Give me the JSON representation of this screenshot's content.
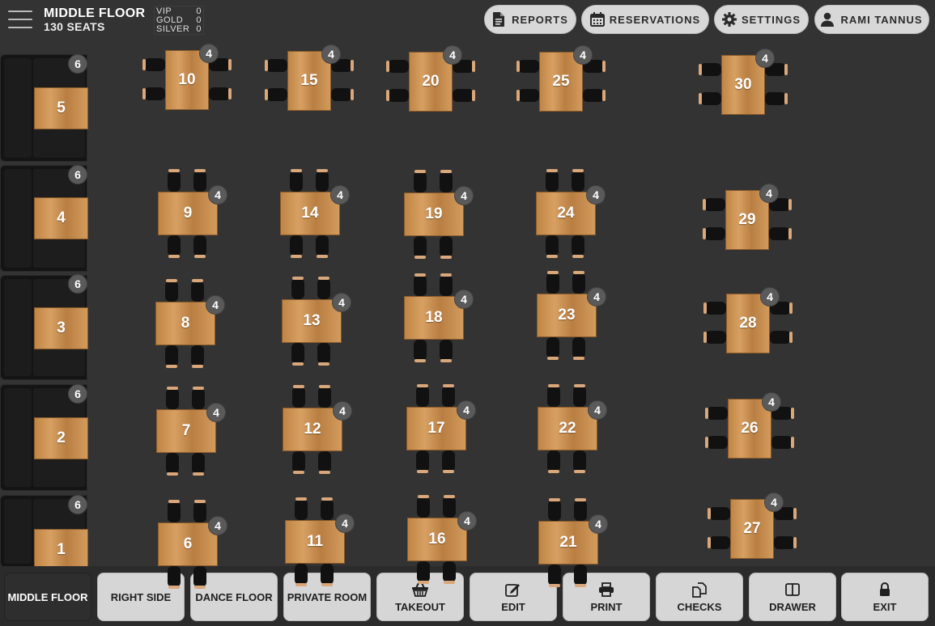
{
  "header": {
    "floor_name": "MIDDLE FLOOR",
    "seats_label": "130 SEATS",
    "tiers": [
      {
        "label": "VIP",
        "count": "0"
      },
      {
        "label": "GOLD",
        "count": "0"
      },
      {
        "label": "SILVER",
        "count": "0"
      }
    ],
    "buttons": {
      "reports": "REPORTS",
      "reservations": "RESERVATIONS",
      "settings": "SETTINGS",
      "user": "RAMI TANNUS"
    },
    "icons": {
      "menu": "hamburger-menu-icon",
      "reports": "document-icon",
      "reservations": "calendar-icon",
      "settings": "gear-icon",
      "user": "user-icon"
    }
  },
  "booths": [
    {
      "number": "5",
      "seats": "6"
    },
    {
      "number": "4",
      "seats": "6"
    },
    {
      "number": "3",
      "seats": "6"
    },
    {
      "number": "2",
      "seats": "6"
    },
    {
      "number": "1",
      "seats": "6"
    }
  ],
  "top_tables": [
    {
      "number": "10",
      "seats": "4"
    },
    {
      "number": "15",
      "seats": "4"
    },
    {
      "number": "20",
      "seats": "4"
    },
    {
      "number": "25",
      "seats": "4"
    },
    {
      "number": "30",
      "seats": "4"
    }
  ],
  "grid_tables": [
    {
      "number": "9",
      "seats": "4"
    },
    {
      "number": "14",
      "seats": "4"
    },
    {
      "number": "19",
      "seats": "4"
    },
    {
      "number": "24",
      "seats": "4"
    },
    {
      "number": "8",
      "seats": "4"
    },
    {
      "number": "13",
      "seats": "4"
    },
    {
      "number": "18",
      "seats": "4"
    },
    {
      "number": "23",
      "seats": "4"
    },
    {
      "number": "7",
      "seats": "4"
    },
    {
      "number": "12",
      "seats": "4"
    },
    {
      "number": "17",
      "seats": "4"
    },
    {
      "number": "22",
      "seats": "4"
    },
    {
      "number": "6",
      "seats": "4"
    },
    {
      "number": "11",
      "seats": "4"
    },
    {
      "number": "16",
      "seats": "4"
    },
    {
      "number": "21",
      "seats": "4"
    }
  ],
  "right_tables": [
    {
      "number": "29",
      "seats": "4"
    },
    {
      "number": "28",
      "seats": "4"
    },
    {
      "number": "26",
      "seats": "4"
    },
    {
      "number": "27",
      "seats": "4"
    }
  ],
  "bottom_bar": {
    "floors": [
      "MIDDLE FLOOR",
      "RIGHT SIDE",
      "DANCE FLOOR",
      "PRIVATE ROOM"
    ],
    "active_floor": "MIDDLE FLOOR",
    "actions": [
      {
        "label": "TAKEOUT",
        "icon": "basket-icon"
      },
      {
        "label": "EDIT",
        "icon": "edit-icon"
      },
      {
        "label": "PRINT",
        "icon": "printer-icon"
      },
      {
        "label": "CHECKS",
        "icon": "checks-icon"
      },
      {
        "label": "DRAWER",
        "icon": "drawer-icon"
      },
      {
        "label": "EXIT",
        "icon": "lock-icon"
      }
    ]
  },
  "colors": {
    "background": "#333333",
    "table_wood": "#c99050",
    "badge": "#5a5a5a",
    "button": "#d6d6d6",
    "active_button": "#2e2e2e"
  }
}
